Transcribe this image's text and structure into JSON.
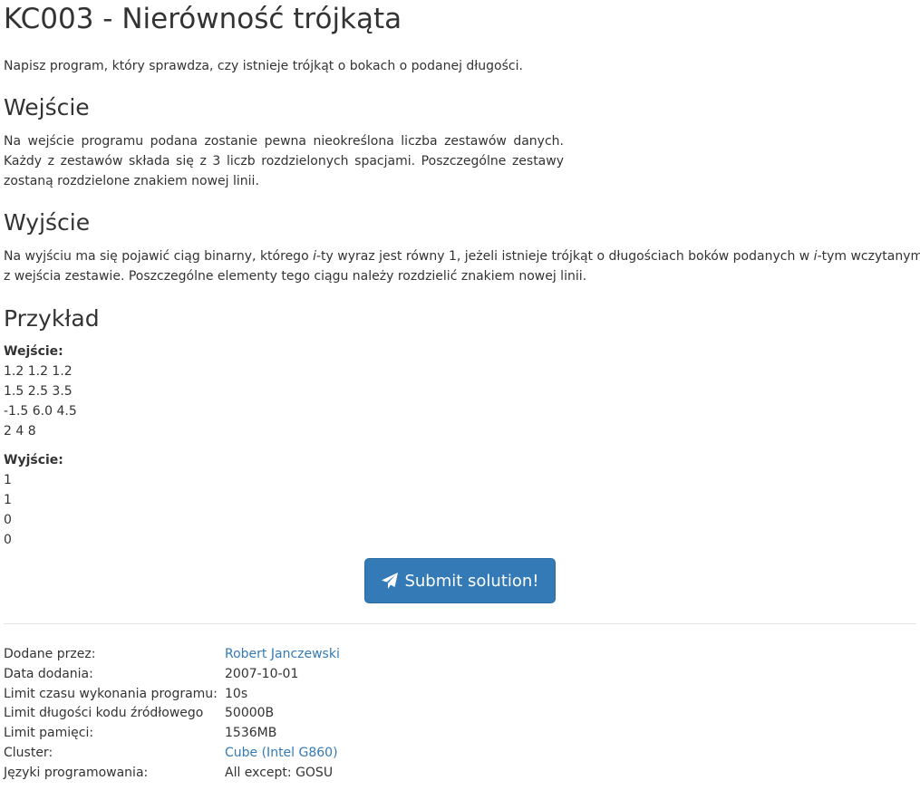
{
  "problem": {
    "title": "KC003 - Nierówność trójkąta",
    "intro": "Napisz program, który sprawdza, czy istnieje trójkąt o bokach o podanej długości."
  },
  "input_section": {
    "heading": "Wejście",
    "lines": [
      "Na wejście programu podana zostanie pewna nieokreślona liczba zestawów danych.",
      "Każdy z zestawów składa się z 3 liczb rozdzielonych spacjami. Poszczególne zestawy",
      "zostaną rozdzielone znakiem nowej linii."
    ]
  },
  "output_section": {
    "heading": "Wyjście",
    "line1_a": "Na wyjściu ma się pojawić ciąg binarny, którego ",
    "line1_i1": "i",
    "line1_b": "-ty wyraz jest równy 1, jeżeli istnieje trójkąt o długościach boków podanych w ",
    "line1_i2": "i",
    "line1_c": "-tym wczytanym",
    "line2": "z wejścia zestawie. Poszczególne elementy tego ciągu należy rozdzielić znakiem nowej linii."
  },
  "example": {
    "heading": "Przykład",
    "input_label": "Wejście:",
    "input_lines": [
      "1.2 1.2 1.2",
      "1.5 2.5 3.5",
      "-1.5 6.0 4.5",
      "2 4 8"
    ],
    "output_label": "Wyjście:",
    "output_lines": [
      "1",
      "1",
      "0",
      "0"
    ]
  },
  "submit": {
    "label": "Submit solution!",
    "icon": "paper-plane-icon",
    "color": "#337ab7"
  },
  "meta": {
    "added_by_label": "Dodane przez:",
    "added_by_value": "Robert Janczewski",
    "date_label": "Data dodania:",
    "date_value": "2007-10-01",
    "time_limit_label": "Limit czasu wykonania programu:",
    "time_limit_value": "10s",
    "code_limit_label": "Limit długości kodu źródłowego",
    "code_limit_value": "50000B",
    "memory_label": "Limit pamięci:",
    "memory_value": "1536MB",
    "cluster_label": "Cluster:",
    "cluster_value": "Cube (Intel G860)",
    "languages_label": "Języki programowania:",
    "languages_value": "All except: GOSU"
  }
}
